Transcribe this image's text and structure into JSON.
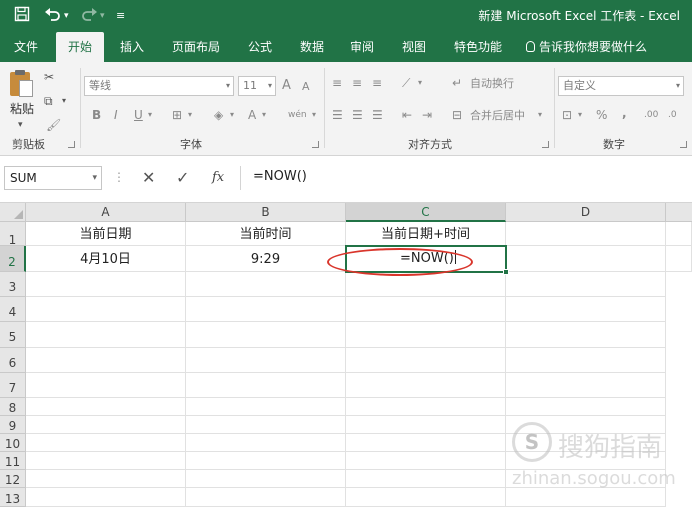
{
  "window": {
    "title": "新建 Microsoft Excel 工作表 - Excel"
  },
  "quick_access": {
    "save_icon": "save-icon",
    "undo_icon": "undo-icon",
    "redo_icon": "redo-icon",
    "customize_icon": "customize-icon"
  },
  "ribbon_tabs": [
    {
      "label": "文件"
    },
    {
      "label": "开始"
    },
    {
      "label": "插入"
    },
    {
      "label": "页面布局"
    },
    {
      "label": "公式"
    },
    {
      "label": "数据"
    },
    {
      "label": "审阅"
    },
    {
      "label": "视图"
    },
    {
      "label": "特色功能"
    }
  ],
  "active_tab": "开始",
  "tell_me": "告诉我你想要做什么",
  "ribbon": {
    "clipboard": {
      "paste_label": "粘贴",
      "group_label": "剪贴板"
    },
    "font": {
      "font_name": "等线",
      "font_size": "11",
      "grow_font": "A",
      "shrink_font": "A",
      "bold": "B",
      "italic": "I",
      "underline": "U",
      "font_color": "A",
      "phonetic": "wén",
      "group_label": "字体"
    },
    "alignment": {
      "wrap_text": "自动换行",
      "merge_center": "合并后居中",
      "group_label": "对齐方式"
    },
    "number": {
      "format": "自定义",
      "percent": "%",
      "comma": ",",
      "increase_decimal": ".00",
      "decrease_decimal": ".0",
      "group_label": "数字"
    }
  },
  "formula_bar": {
    "name_box": "SUM",
    "cancel_icon": "cancel-icon",
    "enter_icon": "enter-icon",
    "fx_label": "fx",
    "formula": "=NOW()"
  },
  "sheet": {
    "columns": [
      "A",
      "B",
      "C",
      "D"
    ],
    "rows": [
      "1",
      "2",
      "3",
      "4",
      "5",
      "6",
      "7",
      "8",
      "9",
      "10",
      "11",
      "12",
      "13"
    ],
    "cells": {
      "A1": "当前日期",
      "B1": "当前时间",
      "C1": "当前日期+时间",
      "A2": "4月10日",
      "B2": "9:29",
      "C2": "=NOW()"
    },
    "active_cell": "C2"
  },
  "watermark": {
    "logo_char": "S",
    "text_cn": "搜狗指南",
    "text_en": "zhinan.sogou.com"
  },
  "colors": {
    "excel_green": "#217346",
    "highlight_red": "#d9352b"
  }
}
